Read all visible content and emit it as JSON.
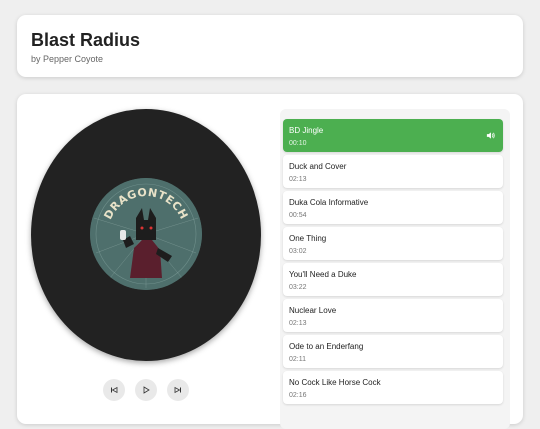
{
  "album": {
    "title": "Blast Radius",
    "artist": "by Pepper Coyote"
  },
  "cover": {
    "label_text": "DRAGONTECH",
    "disc_color": "#222222",
    "label_color": "#4e6f6c"
  },
  "controls": {
    "previous_icon": "skip-previous-icon",
    "play_icon": "play-icon",
    "next_icon": "skip-next-icon"
  },
  "theme": {
    "active_color": "#4caf50"
  },
  "playlist": {
    "now_playing_icon": "speaker-icon",
    "tracks": [
      {
        "title": "BD Jingle",
        "duration": "00:10",
        "active": true
      },
      {
        "title": "Duck and Cover",
        "duration": "02:13",
        "active": false
      },
      {
        "title": "Duka Cola Informative",
        "duration": "00:54",
        "active": false
      },
      {
        "title": "One Thing",
        "duration": "03:02",
        "active": false
      },
      {
        "title": "You'll Need a Duke",
        "duration": "03:22",
        "active": false
      },
      {
        "title": "Nuclear Love",
        "duration": "02:13",
        "active": false
      },
      {
        "title": "Ode to an Enderfang",
        "duration": "02:11",
        "active": false
      },
      {
        "title": "No Cock Like Horse Cock",
        "duration": "02:16",
        "active": false
      }
    ]
  }
}
